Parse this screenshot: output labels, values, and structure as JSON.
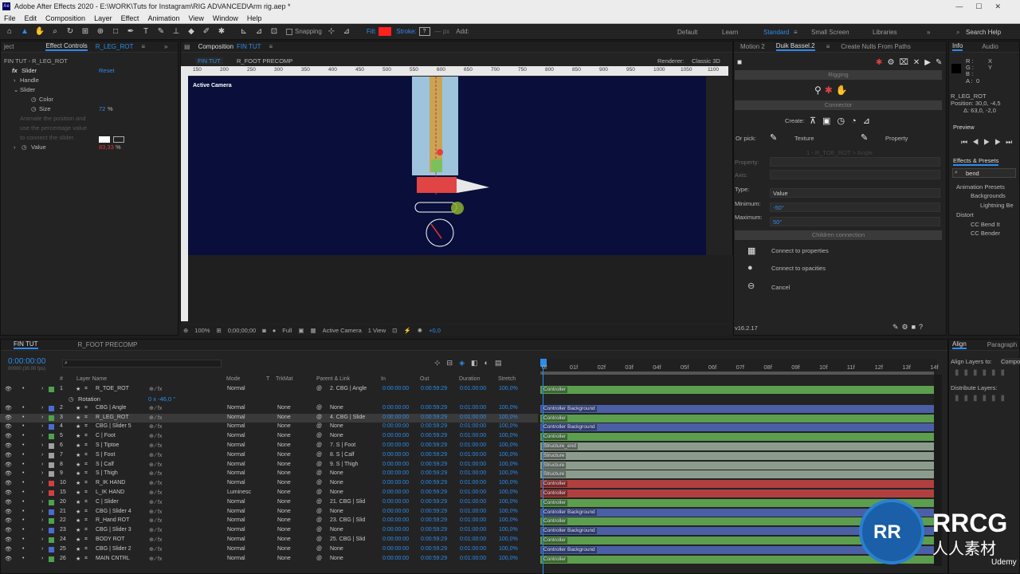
{
  "app": {
    "title": "Adobe After Effects 2020 - E:\\WORK\\Tuts for Instagram\\RIG ADVANCED\\Arm rig.aep *",
    "icon_text": "Ae"
  },
  "menu": [
    "File",
    "Edit",
    "Composition",
    "Layer",
    "Effect",
    "Animation",
    "View",
    "Window",
    "Help"
  ],
  "toolbar": {
    "snapping": "Snapping",
    "fill": "Fill:",
    "stroke": "Stroke:",
    "stroke_value": "?",
    "add": "Add:",
    "workspaces": [
      "Default",
      "Learn",
      "Standard",
      "Small Screen",
      "Libraries"
    ],
    "active_workspace": "Standard",
    "search": "Search Help",
    "fill_color": "#ff2020"
  },
  "effect_controls": {
    "tabs": [
      "ject",
      "Effect Controls",
      "R_LEG_ROT"
    ],
    "layer": "FIN TUT - R_LEG_ROT",
    "fx_name": "Slider",
    "reset": "Reset",
    "items": [
      "Handle",
      "Slider",
      "Color",
      "Size",
      "Value"
    ],
    "size_value": "72",
    "size_unit": "%",
    "hint": [
      "Animate the position and",
      "use the percentage value",
      "to connect the slider."
    ],
    "value": "83,33",
    "value_unit": "%"
  },
  "composition": {
    "tab_label": "Composition",
    "tab_name": "FIN TUT",
    "subtabs": [
      "FIN TUT",
      "R_FOOT PRECOMP"
    ],
    "renderer": "Renderer:",
    "renderer_value": "Classic 3D",
    "camera_label": "Active Camera",
    "ruler_ticks": [
      "150",
      "200",
      "250",
      "300",
      "350",
      "400",
      "450",
      "500",
      "550",
      "600",
      "650",
      "700",
      "750",
      "800",
      "850",
      "900",
      "950",
      "1000",
      "1050",
      "1100"
    ],
    "bottom": {
      "zoom": "100%",
      "time": "0;00;00;00",
      "resolution": "Full",
      "camera": "Active Camera",
      "views": "1 View",
      "exposure": "+0,0"
    }
  },
  "duik": {
    "tabs": [
      "Motion 2",
      "Duik Bassel.2",
      "Create Nulls From Paths"
    ],
    "rigging": "Rigging",
    "connector": "Connector",
    "create": "Create:",
    "or_pick": "Or pick:",
    "texture": "Texture",
    "property_btn": "Property",
    "prop_hint": "1 - R_TOE_ROT > Angle",
    "property": "Property:",
    "axis": "Axis:",
    "type": "Type:",
    "type_value": "Value",
    "minimum": "Minimum:",
    "min_value": "-50°",
    "maximum": "Maximum:",
    "max_value": "50°",
    "children": "Children connection",
    "connect_props": "Connect to properties",
    "connect_opac": "Connect to opacities",
    "cancel": "Cancel",
    "version": "v16.2.17"
  },
  "info": {
    "tabs": [
      "Info",
      "Audio"
    ],
    "r": "R :",
    "g": "G :",
    "b": "B :",
    "a": "A :",
    "a_val": "0",
    "layer": "R_LEG_ROT",
    "position": "Position: 30,0, -4,5",
    "delta": "Δ: 63,0, -2,0",
    "preview": "Preview",
    "effects_presets": "Effects & Presets",
    "search": "bend",
    "tree": [
      "Animation Presets",
      "Backgrounds",
      "Lightning Be",
      "Distort",
      "CC Bend It",
      "CC Bender"
    ]
  },
  "timeline": {
    "tabs": [
      "FIN TUT",
      "R_FOOT PRECOMP"
    ],
    "timecode": "0:00:00:00",
    "fps": "00000 (30.00 fps)",
    "headers": [
      "#",
      "Layer Name",
      "Mode",
      "T",
      "TrkMat",
      "Parent & Link",
      "In",
      "Out",
      "Duration",
      "Stretch"
    ],
    "ruler": [
      "0f",
      "01f",
      "02f",
      "03f",
      "04f",
      "05f",
      "06f",
      "07f",
      "08f",
      "09f",
      "10f",
      "11f",
      "12f",
      "13f",
      "14f"
    ],
    "sub_row": {
      "name": "Rotation",
      "value": "0 x -46,0 °"
    },
    "rows": [
      {
        "n": "1",
        "name": "R_TOE_ROT",
        "mode": "Normal",
        "trk": "",
        "parent": "2. CBG | Angle",
        "bar": "Controller",
        "color": "#5c9e4e",
        "lbl": "#4ea24e"
      },
      {
        "n": "2",
        "name": "CBG | Angle",
        "mode": "Normal",
        "trk": "None",
        "parent": "None",
        "bar": "Controller Background",
        "color": "#4a5fa6",
        "lbl": "#4a6bd0"
      },
      {
        "n": "3",
        "name": "R_LEG_ROT",
        "mode": "Normal",
        "trk": "None",
        "parent": "4. CBG | Slide",
        "bar": "Controller",
        "color": "#5c9e4e",
        "lbl": "#4ea24e"
      },
      {
        "n": "4",
        "name": "CBG | Slider 5",
        "mode": "Normal",
        "trk": "None",
        "parent": "None",
        "bar": "Controller Background",
        "color": "#4a5fa6",
        "lbl": "#4a6bd0"
      },
      {
        "n": "5",
        "name": "C | Foot",
        "mode": "Normal",
        "trk": "None",
        "parent": "None",
        "bar": "Controller",
        "color": "#5c9e4e",
        "lbl": "#4ea24e"
      },
      {
        "n": "6",
        "name": "S | Tiptoe",
        "mode": "Normal",
        "trk": "None",
        "parent": "7. S | Foot",
        "bar": "Structure_end",
        "color": "#8c9c8c",
        "lbl": "#a0a0a0"
      },
      {
        "n": "7",
        "name": "S | Foot",
        "mode": "Normal",
        "trk": "None",
        "parent": "8. S | Calf",
        "bar": "Structure",
        "color": "#8c9c8c",
        "lbl": "#a0a0a0"
      },
      {
        "n": "8",
        "name": "S | Calf",
        "mode": "Normal",
        "trk": "None",
        "parent": "9. S | Thigh",
        "bar": "Structure",
        "color": "#8c9c8c",
        "lbl": "#a0a0a0"
      },
      {
        "n": "9",
        "name": "S | Thigh",
        "mode": "Normal",
        "trk": "None",
        "parent": "None",
        "bar": "Structure",
        "color": "#8c9c8c",
        "lbl": "#a0a0a0"
      },
      {
        "n": "10",
        "name": "R_IK HAND",
        "mode": "Normal",
        "trk": "None",
        "parent": "None",
        "bar": "Controller",
        "color": "#b04040",
        "lbl": "#d04040"
      },
      {
        "n": "15",
        "name": "L_IK HAND",
        "mode": "Luminesc",
        "trk": "None",
        "parent": "None",
        "bar": "Controller",
        "color": "#b04040",
        "lbl": "#d04040"
      },
      {
        "n": "20",
        "name": "C | Slider",
        "mode": "Normal",
        "trk": "None",
        "parent": "21. CBG | Slid",
        "bar": "Controller",
        "color": "#5c9e4e",
        "lbl": "#4ea24e"
      },
      {
        "n": "21",
        "name": "CBG | Slider 4",
        "mode": "Normal",
        "trk": "None",
        "parent": "None",
        "bar": "Controller Background",
        "color": "#4a5fa6",
        "lbl": "#4a6bd0"
      },
      {
        "n": "22",
        "name": "R_Hand ROT",
        "mode": "Normal",
        "trk": "None",
        "parent": "23. CBG | Slid",
        "bar": "Controller",
        "color": "#5c9e4e",
        "lbl": "#4ea24e"
      },
      {
        "n": "23",
        "name": "CBG | Slider 3",
        "mode": "Normal",
        "trk": "None",
        "parent": "None",
        "bar": "Controller Background",
        "color": "#4a5fa6",
        "lbl": "#4a6bd0"
      },
      {
        "n": "24",
        "name": "BODY ROT",
        "mode": "Normal",
        "trk": "None",
        "parent": "25. CBG | Slid",
        "bar": "Controller",
        "color": "#5c9e4e",
        "lbl": "#4ea24e"
      },
      {
        "n": "25",
        "name": "CBG | Slider 2",
        "mode": "Normal",
        "trk": "None",
        "parent": "None",
        "bar": "Controller Background",
        "color": "#4a5fa6",
        "lbl": "#4a6bd0"
      },
      {
        "n": "26",
        "name": "MAIN CNTRL",
        "mode": "Normal",
        "trk": "None",
        "parent": "None",
        "bar": "Controller",
        "color": "#5c9e4e",
        "lbl": "#4ea24e"
      }
    ],
    "in": "0:00:00:00",
    "out": "0:00:59:29",
    "dur": "0:01:00:00",
    "stretch": "100,0%"
  },
  "align": {
    "tabs": [
      "Align",
      "Paragraph"
    ],
    "align_to": "Align Layers to:",
    "align_to_value": "Compo",
    "distribute": "Distribute Layers:"
  },
  "watermark": {
    "brand": "RRCG",
    "sub": "人人素材",
    "udemy": "Udemy"
  }
}
